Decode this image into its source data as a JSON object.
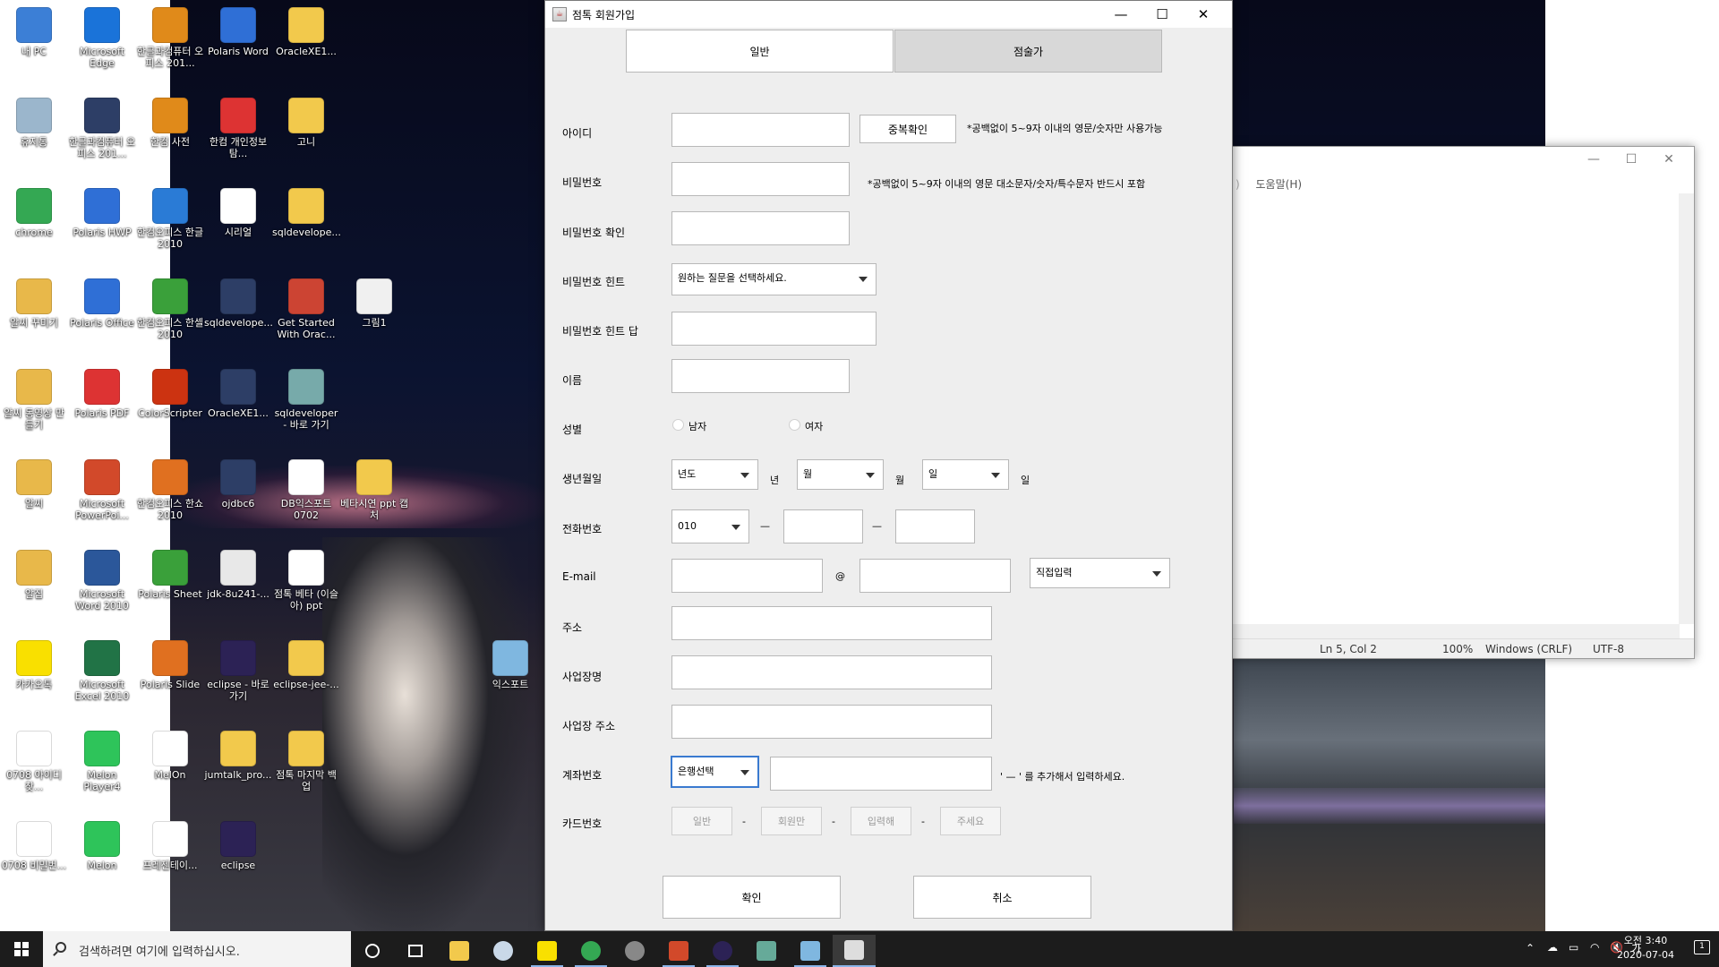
{
  "desktop": {
    "icons": [
      {
        "label": "내 PC",
        "icon": "pc-icon",
        "color": "#3c7fd6"
      },
      {
        "label": "Microsoft Edge",
        "icon": "edge-icon",
        "color": "#1a73d9"
      },
      {
        "label": "한글과컴퓨터 오피스 201...",
        "icon": "hancom-office-icon",
        "color": "#e08a1a"
      },
      {
        "label": "Polaris Word",
        "icon": "polaris-word-icon",
        "color": "#2f6fd6"
      },
      {
        "label": "OracleXE1...",
        "icon": "folder-icon",
        "color": "#f2c94c"
      },
      {
        "label": "휴지통",
        "icon": "recycle-bin-icon",
        "color": "#9bb6cc"
      },
      {
        "label": "한글과컴퓨터 오피스 201...",
        "icon": "zip-icon",
        "color": "#2d3e66"
      },
      {
        "label": "한컴 사전",
        "icon": "hancom-dictionary-icon",
        "color": "#e08a1a"
      },
      {
        "label": "한컴 개인정보탐...",
        "icon": "hancom-privacy-icon",
        "color": "#d33"
      },
      {
        "label": "고니",
        "icon": "folder-icon",
        "color": "#f2c94c"
      },
      {
        "label": "chrome",
        "icon": "chrome-icon",
        "color": "#34a853"
      },
      {
        "label": "Polaris HWP",
        "icon": "polaris-hwp-icon",
        "color": "#2f6fd6"
      },
      {
        "label": "한컴오피스 한글 2010",
        "icon": "hangul-icon",
        "color": "#2a7bd6"
      },
      {
        "label": "시리얼",
        "icon": "text-file-icon",
        "color": "#ffffff"
      },
      {
        "label": "sqldevelope...",
        "icon": "folder-icon",
        "color": "#f2c94c"
      },
      {
        "label": "알씨 꾸미기",
        "icon": "alsee-deco-icon",
        "color": "#e8b84a"
      },
      {
        "label": "Polaris Office",
        "icon": "polaris-office-icon",
        "color": "#2f6fd6"
      },
      {
        "label": "한컴오피스 한셀 2010",
        "icon": "hancell-icon",
        "color": "#3aa03a"
      },
      {
        "label": "sqldevelope...",
        "icon": "zip-icon",
        "color": "#2d3e66"
      },
      {
        "label": "Get Started With Orac...",
        "icon": "oracle-db-icon",
        "color": "#c43"
      },
      {
        "label": "그림1",
        "icon": "image-file-icon",
        "color": "#f0f0f0"
      },
      {
        "label": "알씨 동영상 만들기",
        "icon": "alsee-video-icon",
        "color": "#e8b84a"
      },
      {
        "label": "Polaris PDF",
        "icon": "polaris-pdf-icon",
        "color": "#d33"
      },
      {
        "label": "ColorScripter",
        "icon": "flash-icon",
        "color": "#c31"
      },
      {
        "label": "OracleXE1...",
        "icon": "zip-icon",
        "color": "#2d3e66"
      },
      {
        "label": "sqldeveloper - 바로 가기",
        "icon": "sqldeveloper-icon",
        "color": "#7aa"
      },
      {
        "label": "알씨",
        "icon": "alsee-icon",
        "color": "#e8b84a"
      },
      {
        "label": "Microsoft PowerPoi...",
        "icon": "powerpoint-icon",
        "color": "#d2492a"
      },
      {
        "label": "한컴오피스 한쇼 2010",
        "icon": "hanshow-icon",
        "color": "#e07020"
      },
      {
        "label": "ojdbc6",
        "icon": "jar-icon",
        "color": "#2d3e66"
      },
      {
        "label": "DB익스포트 0702",
        "icon": "text-file-icon",
        "color": "#ffffff"
      },
      {
        "label": "베타시연 ppt 캡처",
        "icon": "folder-icon",
        "color": "#f2c94c"
      },
      {
        "label": "알집",
        "icon": "alzip-icon",
        "color": "#e8b84a"
      },
      {
        "label": "Microsoft Word 2010",
        "icon": "word-icon",
        "color": "#2b579a"
      },
      {
        "label": "Polaris Sheet",
        "icon": "polaris-sheet-icon",
        "color": "#3aa03a"
      },
      {
        "label": "jdk-8u241-...",
        "icon": "java-installer-icon",
        "color": "#e8e8e8"
      },
      {
        "label": "점톡 베타 (이슬아) ppt",
        "icon": "ppt-file-icon",
        "color": "#ffffff"
      },
      {
        "label": "카카오톡",
        "icon": "kakaotalk-icon",
        "color": "#f9e000"
      },
      {
        "label": "Microsoft Excel 2010",
        "icon": "excel-icon",
        "color": "#217346"
      },
      {
        "label": "Polaris Slide",
        "icon": "polaris-slide-icon",
        "color": "#e07020"
      },
      {
        "label": "eclipse - 바로 가기",
        "icon": "eclipse-icon",
        "color": "#2c2255"
      },
      {
        "label": "eclipse-jee-...",
        "icon": "folder-icon",
        "color": "#f2c94c"
      },
      {
        "label": "익스포트",
        "icon": "notepad-icon",
        "color": "#7fb7e0"
      },
      {
        "label": "0708 아이디찾...",
        "icon": "text-file-icon",
        "color": "#ffffff"
      },
      {
        "label": "Melon Player4",
        "icon": "melon-player-icon",
        "color": "#2ec45a"
      },
      {
        "label": "MelOn",
        "icon": "file-icon",
        "color": "#ffffff"
      },
      {
        "label": "jumtalk_pro...",
        "icon": "folder-icon",
        "color": "#f2c94c"
      },
      {
        "label": "점톡 마지막 백업",
        "icon": "folder-icon",
        "color": "#f2c94c"
      },
      {
        "label": "0708 비밀번...",
        "icon": "text-file-icon",
        "color": "#ffffff"
      },
      {
        "label": "Melon",
        "icon": "melon-icon",
        "color": "#2ec45a"
      },
      {
        "label": "프레젠테이...",
        "icon": "presentation-icon",
        "color": "#ffffff"
      },
      {
        "label": "eclipse",
        "icon": "eclipse-icon",
        "color": "#2c2255"
      }
    ]
  },
  "notepad": {
    "menu_help": "도움말(H)",
    "status": {
      "position": "Ln 5, Col 2",
      "zoom": "100%",
      "line_ending": "Windows (CRLF)",
      "encoding": "UTF-8"
    }
  },
  "window": {
    "title": "점톡 회원가입",
    "tabs": {
      "general": "일반",
      "expert": "점술가"
    },
    "labels": {
      "id": "아이디",
      "password": "비밀번호",
      "password_confirm": "비밀번호 확인",
      "password_hint": "비밀번호 힌트",
      "password_hint_answer": "비밀번호 힌트 답",
      "name": "이름",
      "gender": "성별",
      "birth": "생년월일",
      "phone": "전화번호",
      "email": "E-mail",
      "address": "주소",
      "business_name": "사업장명",
      "business_address": "사업장 주소",
      "account": "계좌번호",
      "card": "카드번호"
    },
    "id_check_button": "중복확인",
    "id_note": "*공백없이 5~9자 이내의 영문/숫자만 사용가능",
    "password_note": "*공백없이 5~9자 이내의 영문 대소문자/숫자/특수문자 반드시 포함",
    "hint_select": "원하는 질문을 선택하세요.",
    "gender_options": {
      "male": "남자",
      "female": "여자"
    },
    "birth": {
      "year_select": "년도",
      "year_unit": "년",
      "month_select": "월",
      "month_unit": "월",
      "day_select": "일",
      "day_unit": "일"
    },
    "phone": {
      "prefix": "010",
      "dash1": "—",
      "dash2": "—"
    },
    "email": {
      "at": "@",
      "domain_select": "직접입력"
    },
    "account": {
      "bank_select": "은행선택",
      "note": "' — ' 를 추가해서 입력하세요."
    },
    "card": {
      "part1": "일반",
      "part2": "회원만",
      "part3": "입력해",
      "part4": "주세요",
      "dash": "-"
    },
    "confirm_button": "확인",
    "cancel_button": "취소"
  },
  "taskbar": {
    "search_placeholder": "검색하려면 여기에 입력하십시오.",
    "clock_time": "오전 3:40",
    "clock_date": "2020-07-04",
    "ime": "가",
    "notification_count": "1"
  },
  "colors": {
    "accent": "#3a7ad0",
    "window_bg": "#eeeeee",
    "taskbar": "#1c1c1c"
  }
}
